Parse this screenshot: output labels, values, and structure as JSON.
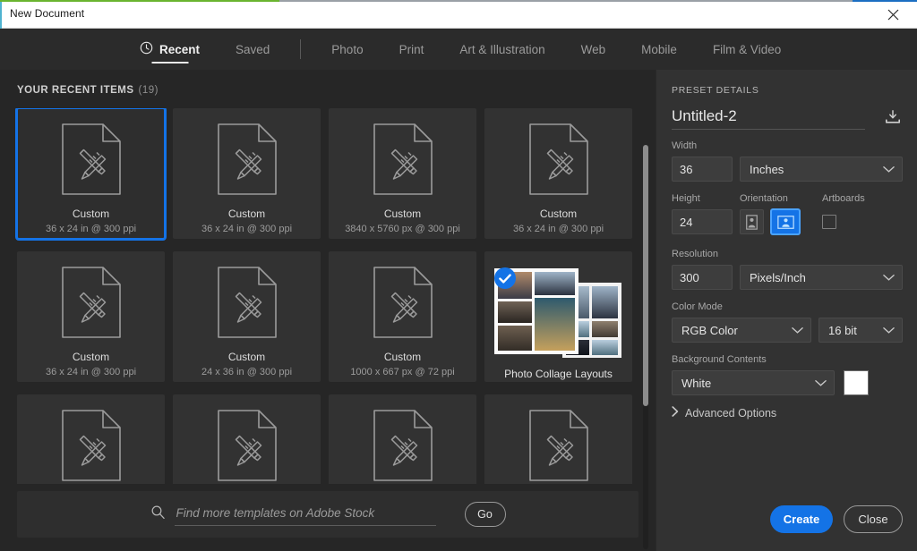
{
  "window": {
    "title": "New Document",
    "close_icon": "close-icon",
    "accent_green": "#6ab42f",
    "accent_blue": "#1b6ec2"
  },
  "tabs": [
    {
      "label": "Recent",
      "icon": "clock-icon",
      "active": true
    },
    {
      "label": "Saved",
      "active": false
    },
    {
      "label": "Photo",
      "active": false
    },
    {
      "label": "Print",
      "active": false
    },
    {
      "label": "Art & Illustration",
      "active": false
    },
    {
      "label": "Web",
      "active": false
    },
    {
      "label": "Mobile",
      "active": false
    },
    {
      "label": "Film & Video",
      "active": false
    }
  ],
  "recent": {
    "heading": "YOUR RECENT ITEMS",
    "count": "(19)",
    "items": [
      {
        "title": "Custom",
        "sub": "36 x 24 in @ 300 ppi",
        "selected": true,
        "kind": "doc"
      },
      {
        "title": "Custom",
        "sub": "36 x 24 in @ 300 ppi",
        "selected": false,
        "kind": "doc"
      },
      {
        "title": "Custom",
        "sub": "3840 x 5760 px @ 300 ppi",
        "selected": false,
        "kind": "doc"
      },
      {
        "title": "Custom",
        "sub": "36 x 24 in @ 300 ppi",
        "selected": false,
        "kind": "doc"
      },
      {
        "title": "Custom",
        "sub": "36 x 24 in @ 300 ppi",
        "selected": false,
        "kind": "doc"
      },
      {
        "title": "Custom",
        "sub": "24 x 36 in @ 300 ppi",
        "selected": false,
        "kind": "doc"
      },
      {
        "title": "Custom",
        "sub": "1000 x 667 px @ 72 ppi",
        "selected": false,
        "kind": "doc"
      },
      {
        "title": "Photo Collage Layouts",
        "sub": "",
        "selected": false,
        "kind": "collage",
        "badge": "check-icon"
      },
      {
        "title": "",
        "sub": "",
        "selected": false,
        "kind": "doc"
      },
      {
        "title": "",
        "sub": "",
        "selected": false,
        "kind": "doc"
      },
      {
        "title": "",
        "sub": "",
        "selected": false,
        "kind": "doc"
      },
      {
        "title": "",
        "sub": "",
        "selected": false,
        "kind": "doc"
      }
    ]
  },
  "stock": {
    "placeholder": "Find more templates on Adobe Stock",
    "value": "",
    "go_label": "Go",
    "search_icon": "search-icon"
  },
  "preset": {
    "heading": "PRESET DETAILS",
    "document_name": "Untitled-2",
    "save_preset_icon": "save-preset-icon",
    "width": {
      "label": "Width",
      "value": "36",
      "unit": "Inches"
    },
    "height": {
      "label": "Height",
      "value": "24"
    },
    "orientation": {
      "label": "Orientation",
      "portrait_icon": "portrait-orientation-icon",
      "landscape_icon": "landscape-orientation-icon",
      "selected": "landscape"
    },
    "artboards": {
      "label": "Artboards",
      "checked": false
    },
    "resolution": {
      "label": "Resolution",
      "value": "300",
      "unit": "Pixels/Inch"
    },
    "color_mode": {
      "label": "Color Mode",
      "value": "RGB Color",
      "depth": "16 bit"
    },
    "background": {
      "label": "Background Contents",
      "value": "White",
      "swatch": "#ffffff"
    },
    "advanced_label": "Advanced Options",
    "advanced_icon": "chevron-right-icon"
  },
  "actions": {
    "create_label": "Create",
    "close_label": "Close",
    "accent": "#1473e6"
  }
}
